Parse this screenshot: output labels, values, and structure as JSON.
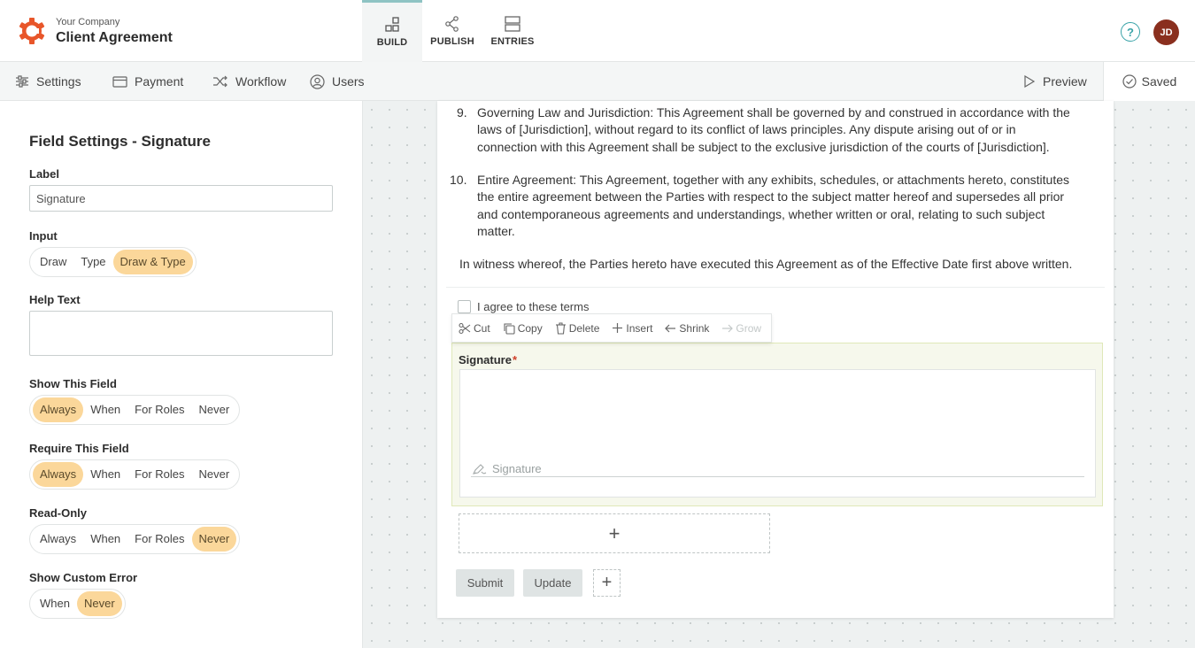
{
  "header": {
    "company": "Your Company",
    "title": "Client Agreement",
    "modes": [
      {
        "label": "BUILD",
        "icon": "build-icon",
        "active": true
      },
      {
        "label": "PUBLISH",
        "icon": "share-icon",
        "active": false
      },
      {
        "label": "ENTRIES",
        "icon": "entries-icon",
        "active": false
      }
    ],
    "help": "?",
    "avatar_initials": "JD",
    "accent": "#e8562a",
    "avatar_color": "#8a2f1e"
  },
  "subbar": {
    "items": [
      "Settings",
      "Payment",
      "Workflow",
      "Users"
    ],
    "preview": "Preview",
    "saved": "Saved"
  },
  "panel": {
    "title": "Field Settings - Signature",
    "label_heading": "Label",
    "label_value": "Signature",
    "input_heading": "Input",
    "input_options": [
      "Draw",
      "Type",
      "Draw & Type"
    ],
    "input_selected": "Draw & Type",
    "help_heading": "Help Text",
    "help_value": "",
    "show_heading": "Show This Field",
    "show_options": [
      "Always",
      "When",
      "For Roles",
      "Never"
    ],
    "show_selected": "Always",
    "require_heading": "Require This Field",
    "require_options": [
      "Always",
      "When",
      "For Roles",
      "Never"
    ],
    "require_selected": "Always",
    "readonly_heading": "Read-Only",
    "readonly_options": [
      "Always",
      "When",
      "For Roles",
      "Never"
    ],
    "readonly_selected": "Never",
    "error_heading": "Show Custom Error",
    "error_options": [
      "When",
      "Never"
    ],
    "error_selected": "Never",
    "selected_color": "#fbd79a"
  },
  "document": {
    "clause9_num": "9.",
    "clause9_lines": [
      "Governing Law and Jurisdiction: This Agreement shall be governed by and construed in accordance with the",
      "laws of [Jurisdiction], without regard to its conflict of laws principles. Any dispute arising out of or in",
      "connection with this Agreement shall be subject to the exclusive jurisdiction of the courts of [Jurisdiction]."
    ],
    "clause10_num": "10.",
    "clause10_lines": [
      "Entire Agreement: This Agreement, together with any exhibits, schedules, or attachments hereto, constitutes",
      "the entire agreement between the Parties with respect to the subject matter hereof and supersedes all prior",
      "and contemporaneous agreements and understandings, whether written or oral, relating to such subject",
      "matter."
    ],
    "witness": "In witness whereof, the Parties hereto have executed this Agreement as of the Effective Date first above written.",
    "agree_label": "I agree to these terms",
    "toolbar": [
      "Cut",
      "Copy",
      "Delete",
      "Insert",
      "Shrink",
      "Grow"
    ],
    "signature_label": "Signature",
    "required_mark": "*",
    "signature_placeholder": "Signature",
    "add_symbol": "+",
    "submit": "Submit",
    "update": "Update"
  }
}
